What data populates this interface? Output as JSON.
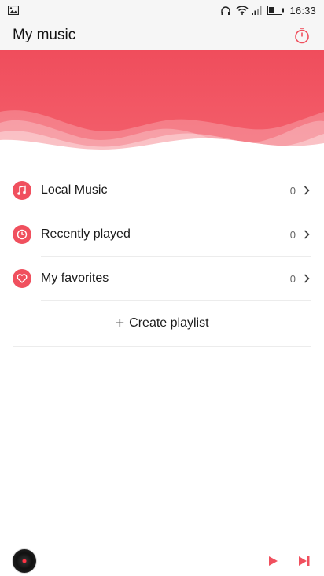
{
  "status_bar": {
    "time": "16:33",
    "icons": [
      "image-icon",
      "headset-alarm-icon",
      "wifi-icon",
      "signal-icon",
      "battery-icon"
    ]
  },
  "app_bar": {
    "title": "My music",
    "timer_icon": "timer-icon"
  },
  "colors": {
    "accent": "#f0505e",
    "header": "#f3606c"
  },
  "list": {
    "items": [
      {
        "label": "Local Music",
        "count": "0",
        "icon": "music-note-icon"
      },
      {
        "label": "Recently played",
        "count": "0",
        "icon": "clock-icon"
      },
      {
        "label": "My favorites",
        "count": "0",
        "icon": "heart-icon"
      }
    ],
    "create_label": "Create playlist"
  },
  "player": {
    "play_icon": "play-icon",
    "next_icon": "skip-next-icon"
  }
}
